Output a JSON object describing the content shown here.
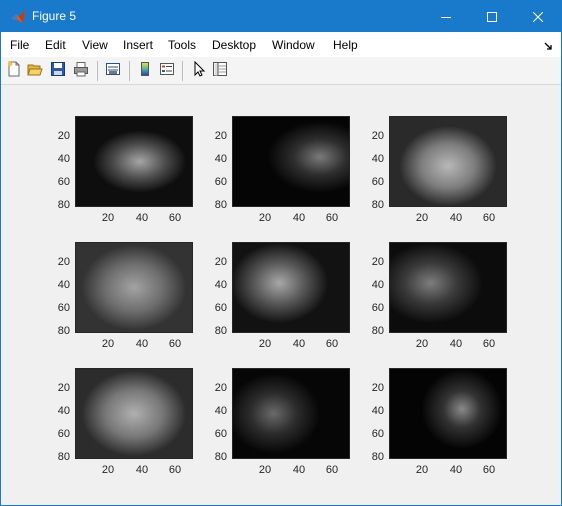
{
  "window": {
    "title": "Figure 5",
    "title_icon": "matlab-icon",
    "controls": [
      "minimize-icon",
      "maximize-icon",
      "close-icon"
    ]
  },
  "menubar": {
    "items": [
      "File",
      "Edit",
      "View",
      "Insert",
      "Tools",
      "Desktop",
      "Window",
      "Help"
    ],
    "dock_icon": "dock-arrow-icon"
  },
  "toolbar": {
    "buttons": [
      "new-figure-icon",
      "open-file-icon",
      "save-icon",
      "print-icon",
      "link-plot-icon",
      "insert-colorbar-icon",
      "insert-legend-icon",
      "edit-plot-icon",
      "property-inspector-icon"
    ]
  },
  "plots": {
    "yticks": [
      "20",
      "40",
      "60",
      "80"
    ],
    "xticks": [
      "20",
      "40",
      "60"
    ],
    "count": 9
  }
}
